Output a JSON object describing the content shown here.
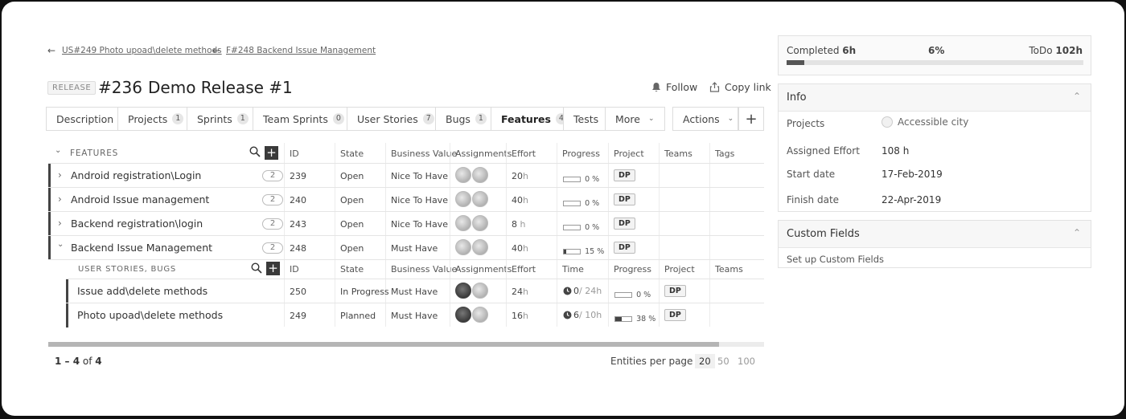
{
  "breadcrumbs": [
    {
      "label": "US#249 Photo upoad\\delete methods"
    },
    {
      "label": "F#248 Backend Issue Management"
    }
  ],
  "entity": {
    "type_tag": "RELEASE",
    "id": "#236",
    "name": "Demo Release #1"
  },
  "actions": {
    "follow": "Follow",
    "copy_link": "Copy link"
  },
  "tabs": [
    {
      "label": "Description",
      "count": ""
    },
    {
      "label": "Projects",
      "count": "1"
    },
    {
      "label": "Sprints",
      "count": "1"
    },
    {
      "label": "Team Sprints",
      "count": "0"
    },
    {
      "label": "User Stories",
      "count": "7"
    },
    {
      "label": "Bugs",
      "count": "1"
    },
    {
      "label": "Features",
      "count": "4"
    },
    {
      "label": "Tests",
      "count": ""
    },
    {
      "label": "More",
      "count": ""
    }
  ],
  "actions_menu": "Actions",
  "features_grid": {
    "section_label": "FEATURES",
    "columns": [
      "ID",
      "State",
      "Business Value",
      "Assignments",
      "Effort",
      "Progress",
      "Project",
      "Teams",
      "Tags"
    ],
    "rows": [
      {
        "name": "Android registration\\Login",
        "count": "2",
        "id": "239",
        "state": "Open",
        "business_value": "Nice To Have",
        "effort": "20",
        "effort_unit": "h",
        "progress": 0,
        "progress_label": "0 %",
        "project": "DP"
      },
      {
        "name": "Android Issue management",
        "count": "2",
        "id": "240",
        "state": "Open",
        "business_value": "Nice To Have",
        "effort": "40",
        "effort_unit": "h",
        "progress": 0,
        "progress_label": "0 %",
        "project": "DP"
      },
      {
        "name": "Backend registration\\login",
        "count": "2",
        "id": "243",
        "state": "Open",
        "business_value": "Nice To Have",
        "effort": "8",
        "effort_unit": " h",
        "progress": 0,
        "progress_label": "0 %",
        "project": "DP"
      },
      {
        "name": "Backend Issue Management",
        "count": "2",
        "id": "248",
        "state": "Open",
        "business_value": "Must Have",
        "effort": "40",
        "effort_unit": "h",
        "progress": 15,
        "progress_label": "15 %",
        "project": "DP"
      }
    ]
  },
  "sub_grid": {
    "section_label": "USER STORIES, BUGS",
    "columns": [
      "ID",
      "State",
      "Business Value",
      "Assignments",
      "Effort",
      "Time",
      "Progress",
      "Project",
      "Teams"
    ],
    "rows": [
      {
        "name": "Issue add\\delete methods",
        "id": "250",
        "state": "In Progress",
        "business_value": "Must Have",
        "effort": "24",
        "effort_unit": "h",
        "time_spent": "0",
        "time_total": "/ 24h",
        "progress": 0,
        "progress_label": "0 %",
        "project": "DP"
      },
      {
        "name": "Photo upoad\\delete methods",
        "id": "249",
        "state": "Planned",
        "business_value": "Must Have",
        "effort": "16",
        "effort_unit": "h",
        "time_spent": "6",
        "time_total": "/ 10h",
        "progress": 38,
        "progress_label": "38 %",
        "project": "DP"
      }
    ]
  },
  "pagination": {
    "range": "1 – 4",
    "of_label": "of",
    "total": "4",
    "per_page_label": "Entities per page",
    "options": [
      "20",
      "50",
      "100"
    ],
    "selected": "20"
  },
  "summary": {
    "completed_label": "Completed",
    "completed_value": "6h",
    "percent": "6%",
    "percent_value": 6,
    "todo_label": "ToDo",
    "todo_value": "102h"
  },
  "info": {
    "title": "Info",
    "fields": [
      {
        "label": "Projects",
        "value": "Accessible city"
      },
      {
        "label": "Assigned Effort",
        "value": "108 h"
      },
      {
        "label": "Start date",
        "value": "17-Feb-2019"
      },
      {
        "label": "Finish date",
        "value": "22-Apr-2019"
      }
    ]
  },
  "custom_fields": {
    "title": "Custom Fields",
    "setup_link": "Set up Custom Fields"
  }
}
